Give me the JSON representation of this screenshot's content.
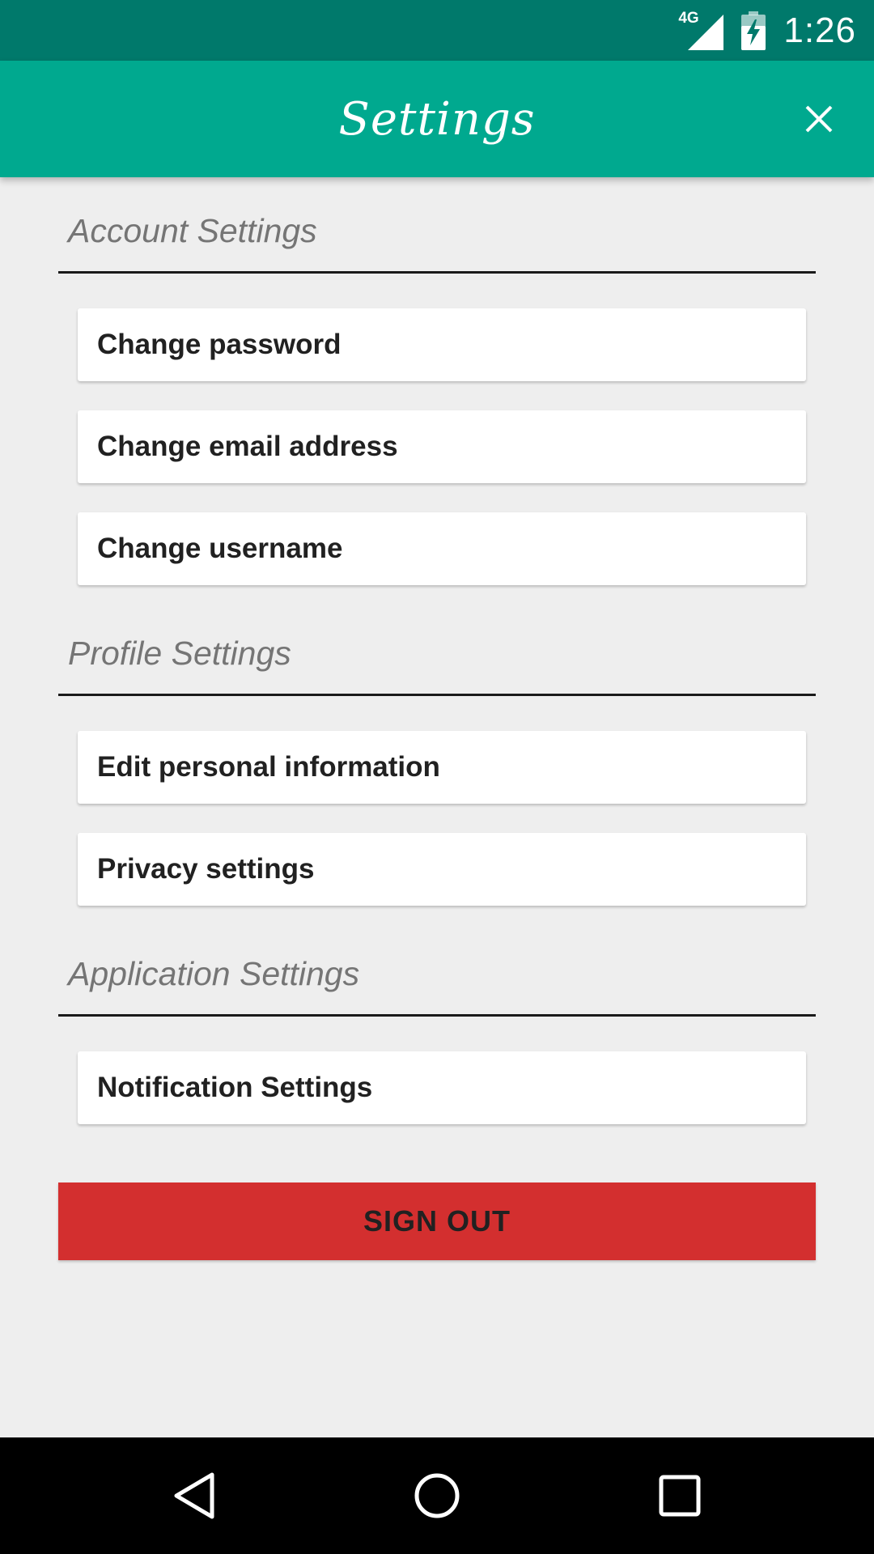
{
  "status_bar": {
    "network_label": "4G",
    "time": "1:26",
    "icons": [
      "signal-icon",
      "battery-charging-icon"
    ]
  },
  "app_bar": {
    "title": "Settings",
    "close_icon": "close-icon"
  },
  "sections": {
    "account": {
      "title": "Account Settings",
      "items": [
        "Change password",
        "Change email address",
        "Change username"
      ]
    },
    "profile": {
      "title": "Profile Settings",
      "items": [
        "Edit personal information",
        "Privacy settings"
      ]
    },
    "application": {
      "title": "Application Settings",
      "items": [
        "Notification Settings"
      ]
    }
  },
  "sign_out_label": "SIGN OUT",
  "nav_bar": {
    "icons": [
      "back-icon",
      "home-icon",
      "recents-icon"
    ]
  },
  "colors": {
    "status_bar": "#00796b",
    "app_bar": "#00a98f",
    "background": "#eeeeee",
    "sign_out": "#d32f2f"
  }
}
